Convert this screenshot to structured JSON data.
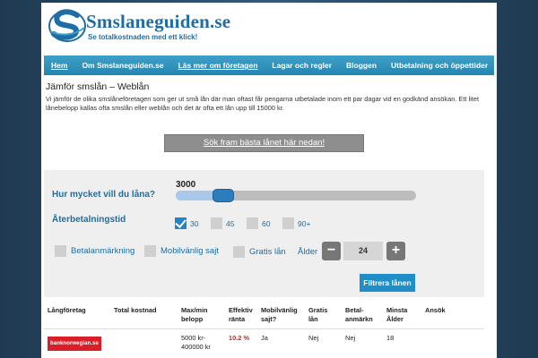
{
  "brand": {
    "title": "Smslaneguiden.se",
    "tagline": "Se totalkostnaden med ett klick!",
    "logo_icon": "swoosh-s-logo",
    "accent": "#1e6da6"
  },
  "nav": {
    "items": [
      {
        "label": "Hem"
      },
      {
        "label": "Om Smslaneguiden.se"
      },
      {
        "label": "Läs mer om företagen"
      },
      {
        "label": "Lagar och regler"
      },
      {
        "label": "Bloggen"
      },
      {
        "label": "Utbetalning och öppettider"
      }
    ]
  },
  "intro": {
    "title": "Jämför smslån – Weblån",
    "text": "Vi jämför de olika smslåneföretagen som ger ut små lån där man oftast får pengarna utbetalade inom ett par dagar vid en godkänd ansökan. Ett litet lånebelopp kallas ofta smslån eller weblån och det är ofta ett lån upp till 15000 kr.",
    "cta": "Sök fram bästa lånet här nedan!"
  },
  "calculator": {
    "amount_label": "Hur mycket vill du låna?",
    "amount_value": "3000",
    "slider_fraction": 0.17,
    "repayment_label": "Återbetalningstid",
    "repayment_options": [
      {
        "label": "30",
        "checked": true
      },
      {
        "label": "45",
        "checked": false
      },
      {
        "label": "60",
        "checked": false
      },
      {
        "label": "90+",
        "checked": false
      }
    ],
    "features": [
      {
        "label": "Betalanmärkning",
        "checked": false
      },
      {
        "label": "Mobilvänlig sajt",
        "checked": false
      },
      {
        "label": "Gratis lån",
        "checked": false
      }
    ],
    "age_label": "Ålder",
    "age_minus": "−",
    "age_plus": "+",
    "age_value": "24",
    "filter_button": "Filtrera lånen"
  },
  "table": {
    "headers": [
      "Långföretag",
      "Total kostnad",
      "Max/min belopp",
      "Effektiv ränta",
      "Mobilvänlig sajt?",
      "Gratis lån",
      "Betal- anmärkn",
      "Minsta Ålder",
      "Ansök"
    ],
    "rows": [
      {
        "lender": "banknorwegian.se",
        "total_cost": "",
        "amount": "5000 kr- 400000 kr",
        "rate": "10.2 %",
        "mobile": "Ja",
        "free": "Nej",
        "remark": "Nej",
        "min_age": "18",
        "apply": ""
      }
    ]
  }
}
